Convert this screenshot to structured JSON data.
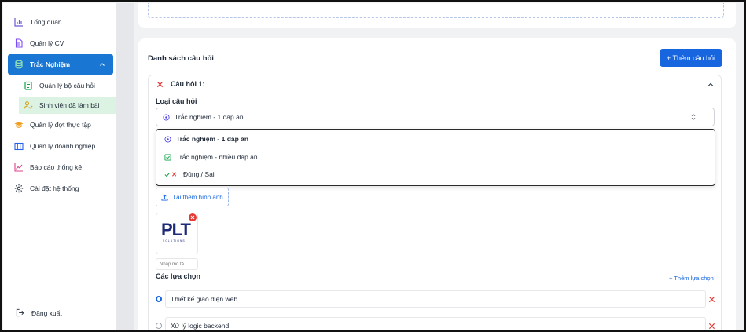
{
  "sidebar": {
    "items": [
      {
        "label": "Tổng quan",
        "icon": "bar-chart-icon"
      },
      {
        "label": "Quản lý CV",
        "icon": "document-icon"
      },
      {
        "label": "Trắc Nghiệm",
        "icon": "database-icon",
        "active": true
      },
      {
        "label": "Quản lý đợt thực tập",
        "icon": "graduation-cap-icon"
      },
      {
        "label": "Quản lý doanh nghiệp",
        "icon": "building-icon"
      },
      {
        "label": "Báo cáo thống kê",
        "icon": "line-chart-icon"
      },
      {
        "label": "Cài đặt hệ thống",
        "icon": "gear-icon"
      }
    ],
    "sub_items": [
      {
        "label": "Quản lý bộ câu hỏi",
        "icon": "clipboard-icon"
      },
      {
        "label": "Sinh viên đã làm bài",
        "icon": "user-check-icon",
        "selected": true
      }
    ],
    "logout": "Đăng xuất"
  },
  "main": {
    "section_title": "Danh sách câu hỏi",
    "add_question_label": "+ Thêm câu hỏi",
    "question": {
      "title": "Câu hỏi 1:",
      "type_label": "Loại câu hỏi",
      "type_value": "Trắc nghiệm - 1 đáp án",
      "type_options": [
        {
          "label": "Trắc nghiệm - 1 đáp án",
          "icon": "radio-circle-icon"
        },
        {
          "label": "Trắc nghiệm - nhiều đáp án",
          "icon": "checkbox-icon"
        },
        {
          "label": "Đúng / Sai",
          "icon": "check-cross-icon"
        }
      ],
      "upload_label": "Tải thêm hình ảnh",
      "image_logo_text": "PLT",
      "image_logo_sub": "SOLUTIONS",
      "description_placeholder": "Nhập mô tả",
      "choices_label": "Các lựa chọn",
      "add_choice_label": "+ Thêm lựa chọn",
      "choices": [
        {
          "text": "Thiết kế giao diện web",
          "selected": true
        },
        {
          "text": "Xử lý logic backend",
          "selected": false
        }
      ]
    }
  },
  "colors": {
    "primary": "#1766e0",
    "sidebar_active": "#1976d2",
    "sub_selected": "#dcf3e3",
    "danger": "#e53935"
  }
}
